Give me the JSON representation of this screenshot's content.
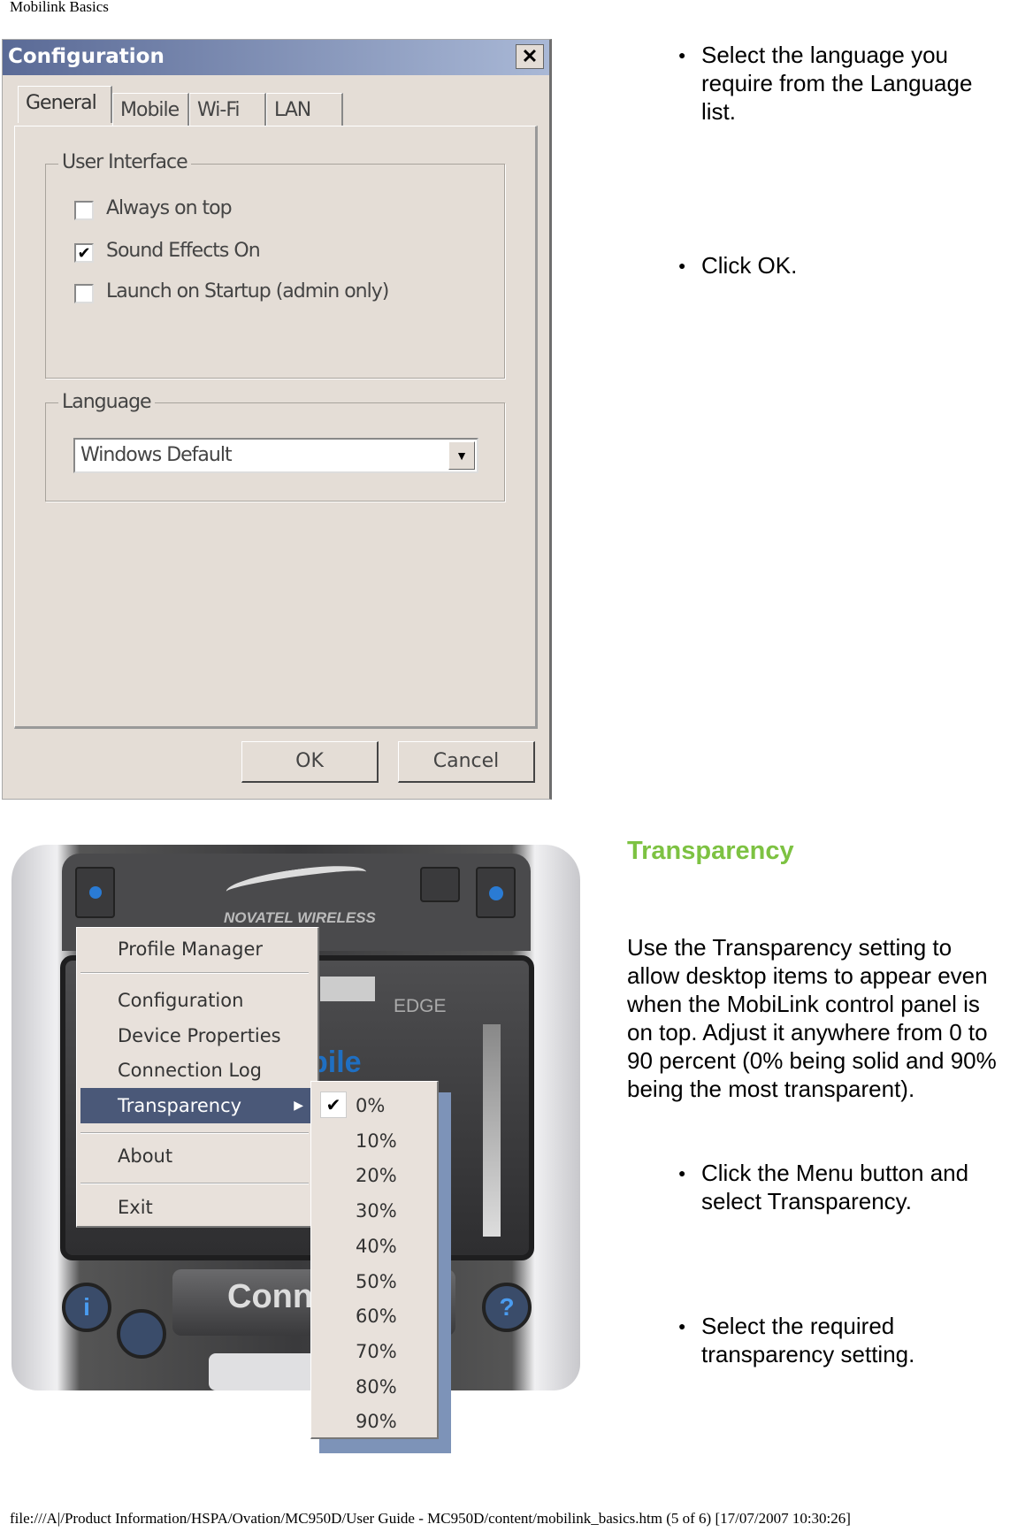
{
  "page_header": "Mobilink Basics",
  "footer": "file:///A|/Product Information/HSPA/Ovation/MC950D/User Guide - MC950D/content/mobilink_basics.htm (5 of 6) [17/07/2007 10:30:26]",
  "config_dialog": {
    "title": "Configuration",
    "tabs": [
      "General",
      "Mobile",
      "Wi-Fi",
      "LAN"
    ],
    "active_tab": "General",
    "user_interface": {
      "label": "User Interface",
      "options": [
        {
          "label": "Always on top",
          "checked": false
        },
        {
          "label": "Sound Effects On",
          "checked": true
        },
        {
          "label": "Launch on Startup (admin only)",
          "checked": false
        }
      ]
    },
    "language": {
      "label": "Language",
      "value": "Windows Default"
    },
    "ok": "OK",
    "cancel": "Cancel"
  },
  "steps_language": [
    "Select the language you require from the Language list.",
    "Click OK."
  ],
  "transparency": {
    "heading": "Transparency",
    "heading_color": "#7dc242",
    "body": "Use the Transparency setting to allow desktop items to appear even when the MobiLink control panel is on top. Adjust it anywhere from 0 to 90 percent (0% being solid and 90% being the most transparent).",
    "steps": [
      "Click the Menu button and select Transparency.",
      "Select the required transparency setting."
    ]
  },
  "mobilink_window": {
    "brand": "NOVATEL WIRELESS",
    "network": "EDGE",
    "partial_text": "bile",
    "connect_partial": "Conn",
    "menu": [
      "Profile Manager",
      "Configuration",
      "Device Properties",
      "Connection Log",
      "Transparency",
      "About",
      "Exit"
    ],
    "highlighted": "Transparency",
    "submenu": [
      "0%",
      "10%",
      "20%",
      "30%",
      "40%",
      "50%",
      "60%",
      "70%",
      "80%",
      "90%"
    ],
    "selected": "0%"
  }
}
